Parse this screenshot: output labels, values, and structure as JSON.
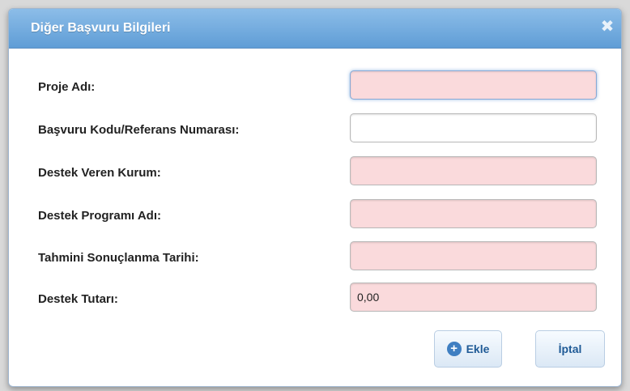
{
  "dialog": {
    "title": "Diğer Başvuru Bilgileri",
    "close_symbol": "✖"
  },
  "form": {
    "fields": [
      {
        "label": "Proje Adı:",
        "value": "",
        "placeholder": ""
      },
      {
        "label": "Başvuru Kodu/Referans Numarası:",
        "value": "",
        "placeholder": ""
      },
      {
        "label": "Destek Veren Kurum:",
        "value": "",
        "placeholder": ""
      },
      {
        "label": "Destek Programı Adı:",
        "value": "",
        "placeholder": ""
      },
      {
        "label": "Tahmini Sonuçlanma Tarihi:",
        "value": "",
        "placeholder": ""
      },
      {
        "label": "Destek Tutarı:",
        "value": "0,00",
        "placeholder": ""
      }
    ]
  },
  "buttons": {
    "add_label": "Ekle",
    "cancel_label": "İptal"
  },
  "icons": {
    "close": "close-icon",
    "add": "plus-circle-icon"
  },
  "colors": {
    "titlebar": "#6fa8dd",
    "required_field": "#fadadc",
    "button_text": "#1f5a96"
  }
}
